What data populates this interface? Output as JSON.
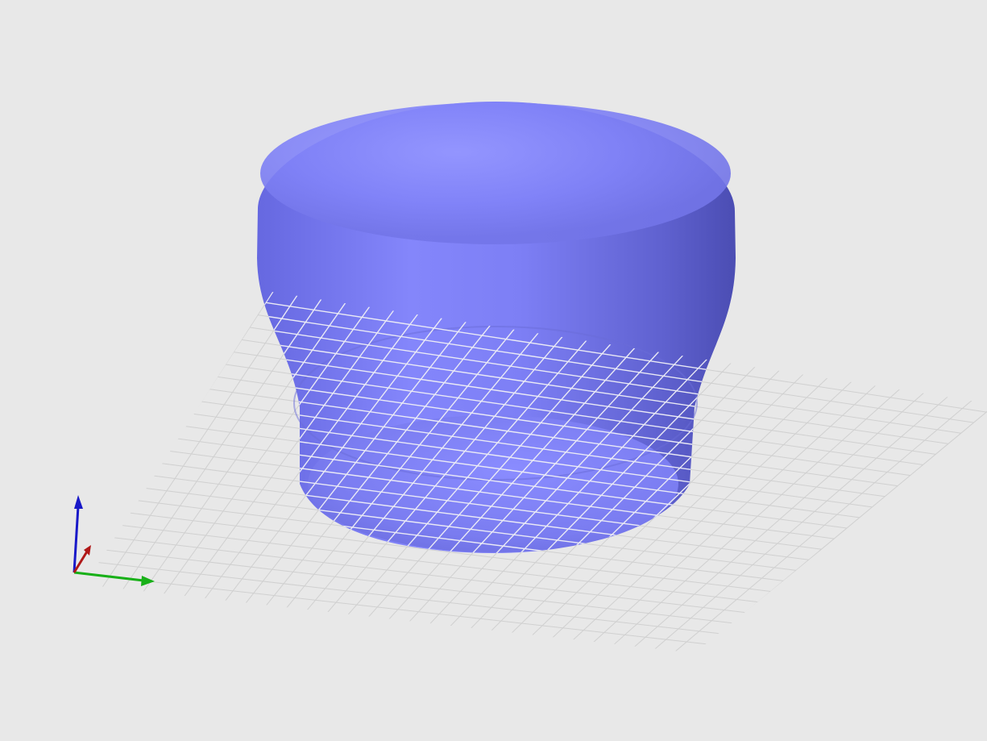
{
  "viewport": {
    "background": "#e8e8e8"
  },
  "scene": {
    "object": {
      "type": "revolved-solid",
      "shape": "flared-cup",
      "color": "#7d7ff5"
    },
    "ground_grid": {
      "visible": true,
      "color": "#d0d0d0",
      "overlay_color": "#eaeaf5"
    },
    "axis_triad": {
      "visible": true,
      "axes": [
        {
          "axis": "x",
          "color": "#b01818",
          "icon": "x-axis-arrow-icon"
        },
        {
          "axis": "y",
          "color": "#18b018",
          "icon": "y-axis-arrow-icon"
        },
        {
          "axis": "z",
          "color": "#1818c8",
          "icon": "z-axis-arrow-icon"
        }
      ]
    }
  }
}
